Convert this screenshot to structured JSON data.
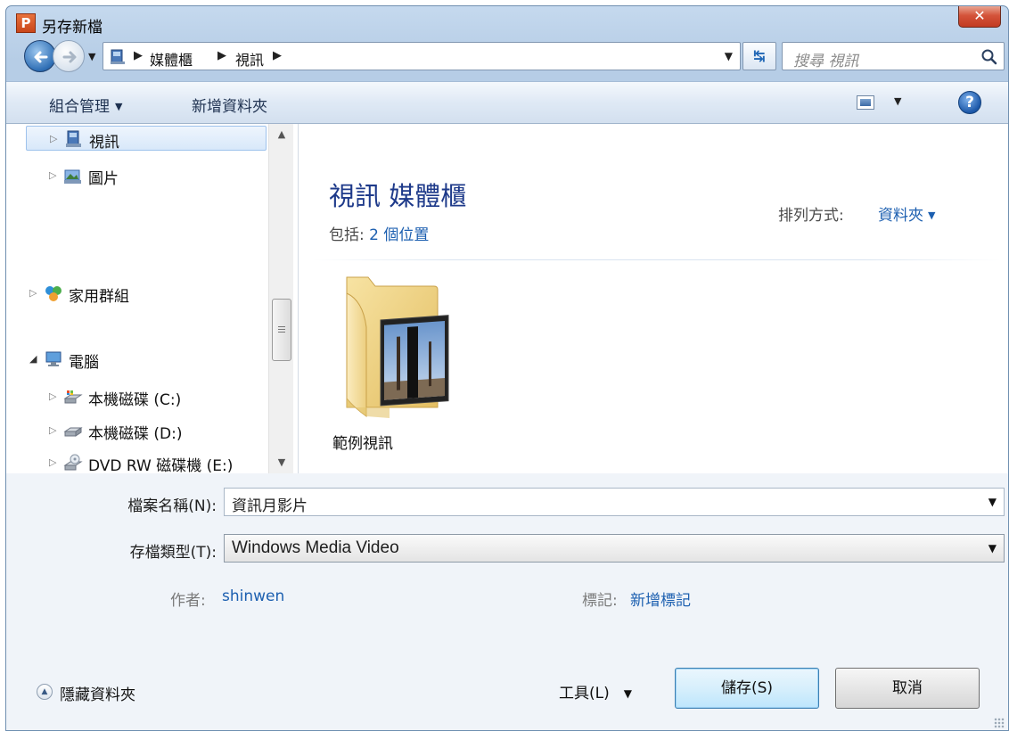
{
  "window": {
    "title": "另存新檔",
    "app_icon": "P",
    "close_glyph": "✕"
  },
  "nav": {
    "breadcrumbs": [
      "媒體櫃",
      "視訊"
    ],
    "search_placeholder": "搜尋 視訊",
    "icons": [
      "back-arrow-icon",
      "forward-arrow-icon",
      "library-icon",
      "refresh-icon",
      "search-icon"
    ]
  },
  "toolbar": {
    "organize": "組合管理",
    "new_folder": "新增資料夾",
    "help": "?"
  },
  "tree": {
    "items": [
      {
        "label": "視訊",
        "icon": "video-library-icon",
        "selected": true
      },
      {
        "label": "圖片",
        "icon": "picture-library-icon"
      },
      {
        "label": "家用群組",
        "icon": "homegroup-icon"
      },
      {
        "label": "電腦",
        "icon": "computer-icon",
        "expanded": true
      },
      {
        "label": "本機磁碟 (C:)",
        "icon": "system-drive-icon"
      },
      {
        "label": "本機磁碟 (D:)",
        "icon": "drive-icon"
      },
      {
        "label": "DVD RW 磁碟機 (E:)",
        "icon": "dvd-drive-icon"
      }
    ]
  },
  "content": {
    "library_title": "視訊 媒體櫃",
    "includes_label": "包括:",
    "includes_link": "2 個位置",
    "arrange_label": "排列方式:",
    "arrange_value": "資料夾",
    "items": [
      {
        "label": "範例視訊",
        "icon": "folder-icon"
      }
    ]
  },
  "form": {
    "filename_label": "檔案名稱(N):",
    "filename_value": "資訊月影片",
    "filetype_label": "存檔類型(T):",
    "filetype_value": "Windows Media Video",
    "author_label": "作者:",
    "author_value": "shinwen",
    "tags_label": "標記:",
    "tags_value": "新增標記"
  },
  "footer": {
    "hide_folders": "隱藏資料夾",
    "tools": "工具(L)",
    "save": "儲存(S)",
    "cancel": "取消"
  }
}
